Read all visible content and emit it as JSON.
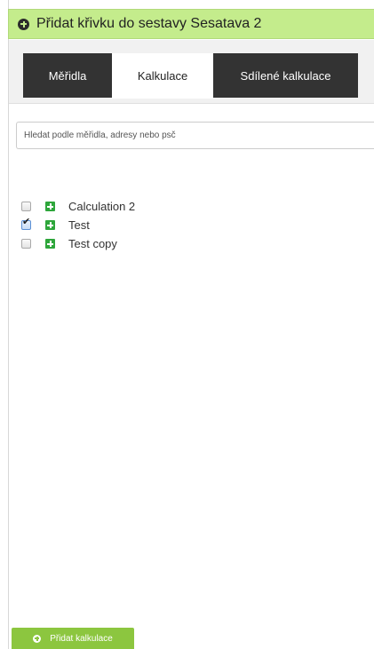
{
  "header": {
    "title": "Přidat křivku do sestavy Sesatava 2",
    "icon": "add-circle-icon",
    "background": "#c4ec8c"
  },
  "tabs": [
    {
      "label": "Měřidla",
      "active": false
    },
    {
      "label": "Kalkulace",
      "active": true
    },
    {
      "label": "Sdílené kalkulace",
      "active": false
    }
  ],
  "search": {
    "value": "",
    "placeholder": "Hledat podle měřidla, adresy nebo psč"
  },
  "list": [
    {
      "label": "Calculation 2",
      "checked": false,
      "icon": "green-plus-icon"
    },
    {
      "label": "Test",
      "checked": true,
      "icon": "green-plus-icon"
    },
    {
      "label": "Test copy",
      "checked": false,
      "icon": "green-plus-icon"
    }
  ],
  "footer": {
    "add_label": "Přidat kalkulace",
    "add_icon": "add-circle-icon",
    "button_color": "#8cc63f"
  }
}
